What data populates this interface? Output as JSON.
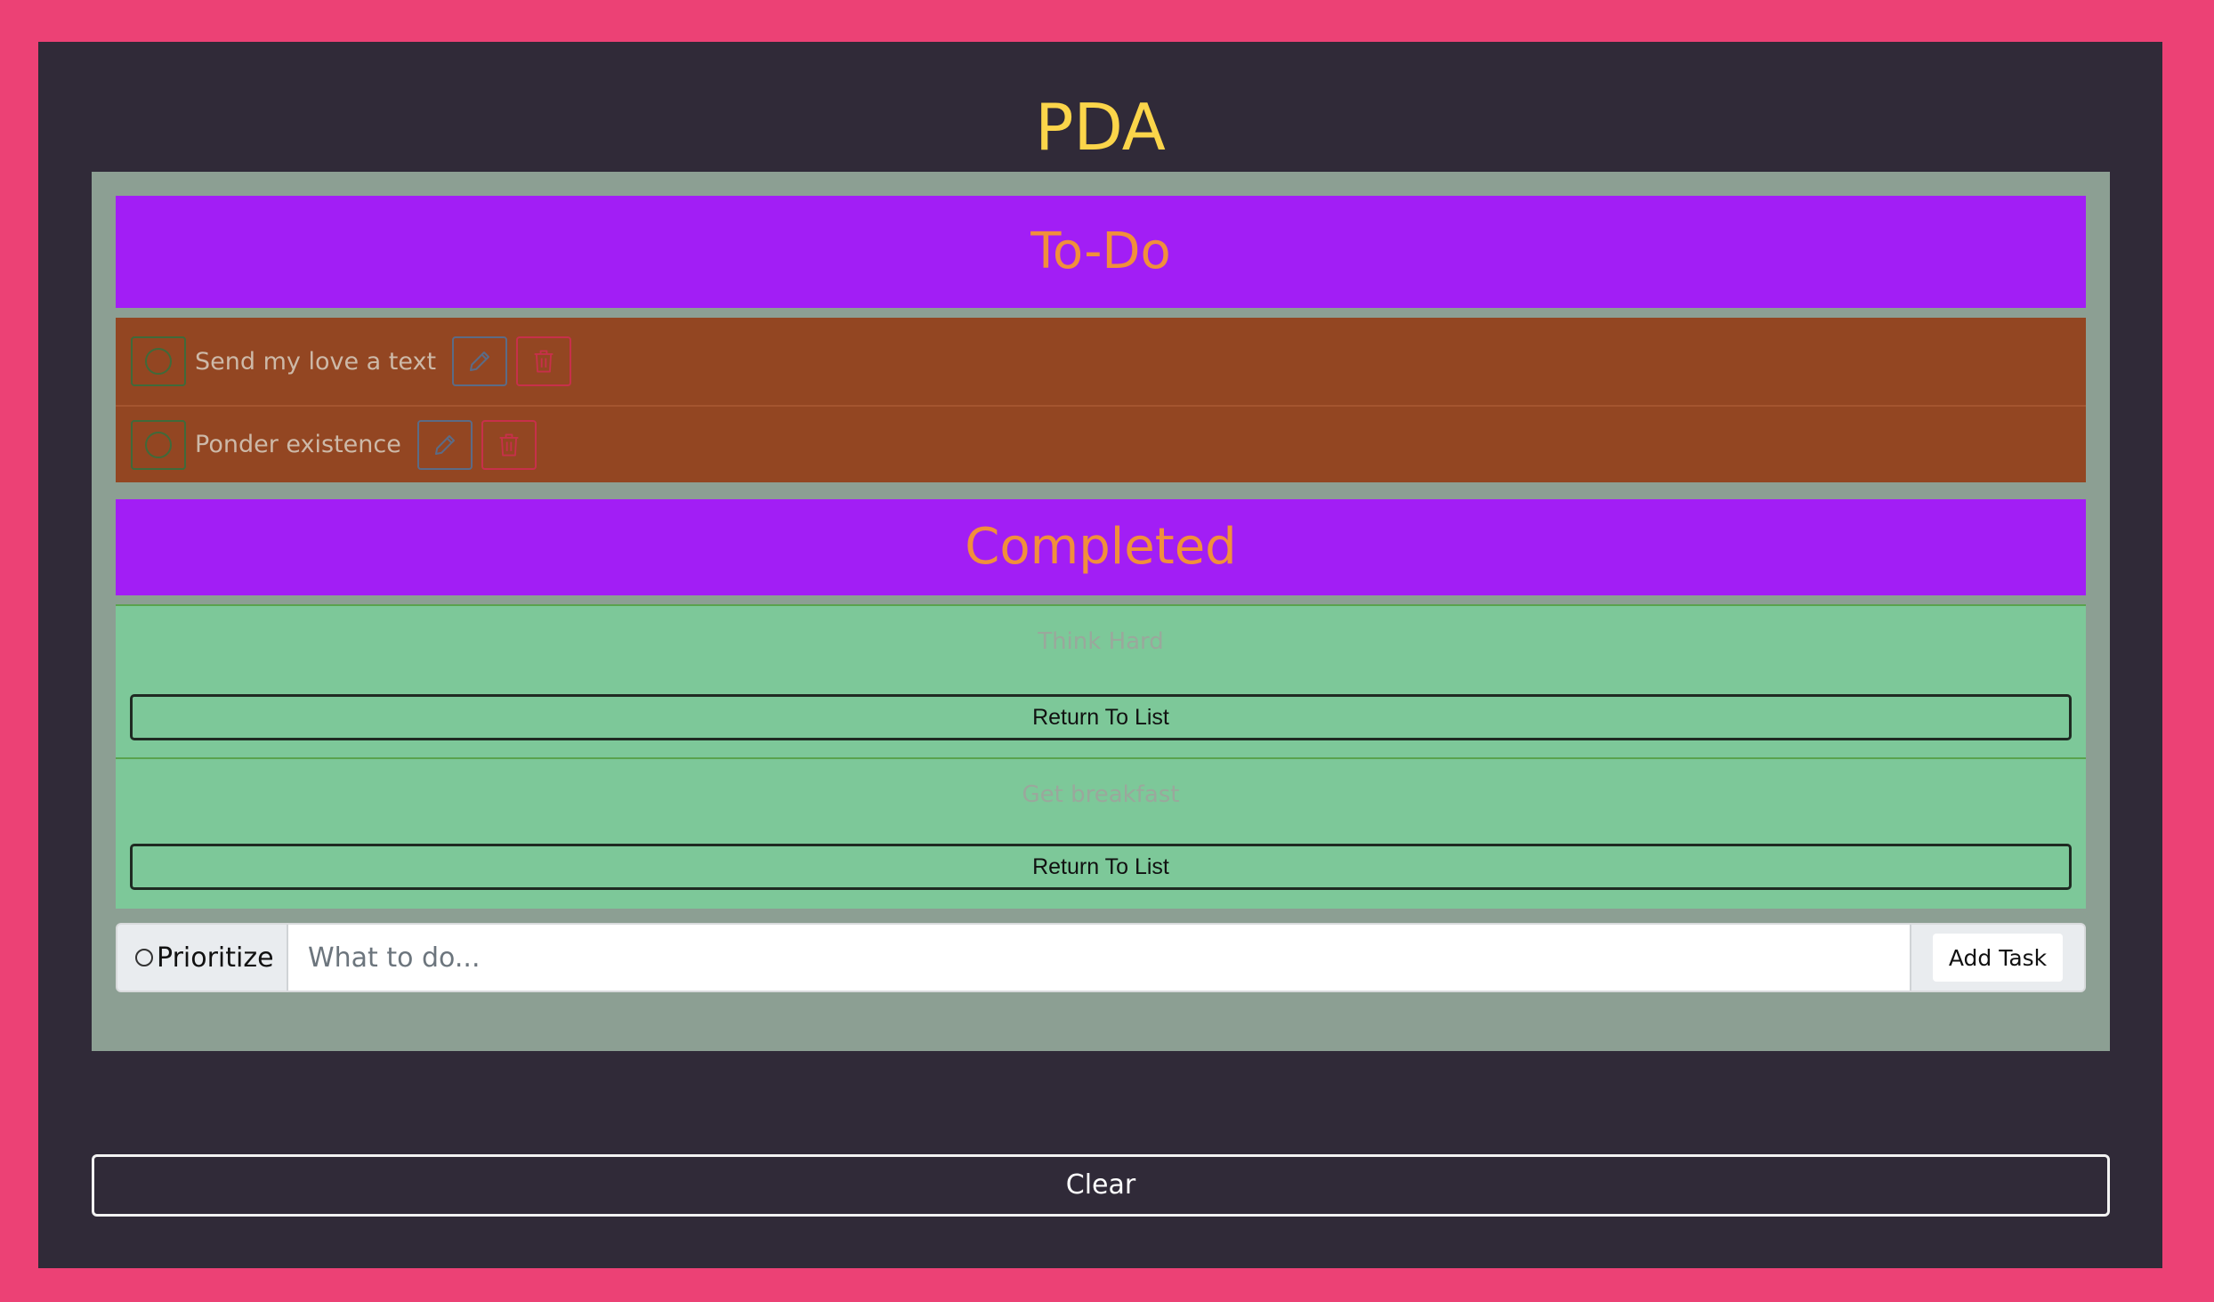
{
  "app": {
    "title": "PDA"
  },
  "todo": {
    "header": "To-Do",
    "items": [
      {
        "text": "Send my love a text"
      },
      {
        "text": "Ponder existence"
      }
    ]
  },
  "completed": {
    "header": "Completed",
    "items": [
      {
        "text": "Think Hard",
        "button": "Return To List"
      },
      {
        "text": "Get breakfast",
        "button": "Return To List"
      }
    ]
  },
  "form": {
    "prioritize_label": "Prioritize",
    "placeholder": "What to do...",
    "add_label": "Add Task"
  },
  "clear_label": "Clear",
  "colors": {
    "frame": "#ec4175",
    "background": "#302a38",
    "panel": "#8c9f93",
    "header": "#a21ef5",
    "header_text": "#f18f3b",
    "title": "#fbd54a",
    "todo_bg": "#934622",
    "done_bg": "#7dc899"
  },
  "icons": {
    "complete": "circle-icon",
    "edit": "pencil-icon",
    "delete": "trash-icon"
  }
}
